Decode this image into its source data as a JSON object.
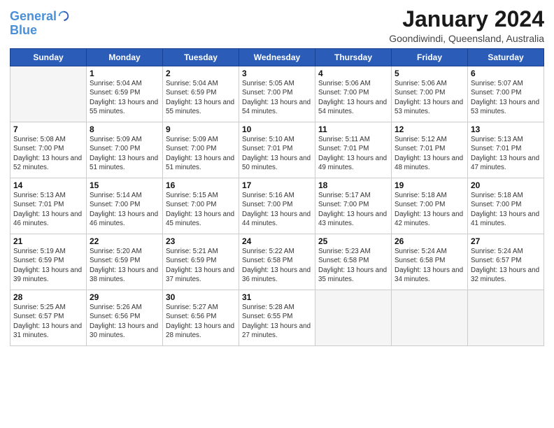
{
  "header": {
    "logo_line1": "General",
    "logo_line2": "Blue",
    "month": "January 2024",
    "location": "Goondiwindi, Queensland, Australia"
  },
  "weekdays": [
    "Sunday",
    "Monday",
    "Tuesday",
    "Wednesday",
    "Thursday",
    "Friday",
    "Saturday"
  ],
  "weeks": [
    [
      {
        "day": null
      },
      {
        "day": 1,
        "sunrise": "5:04 AM",
        "sunset": "6:59 PM",
        "daylight": "13 hours and 55 minutes."
      },
      {
        "day": 2,
        "sunrise": "5:04 AM",
        "sunset": "6:59 PM",
        "daylight": "13 hours and 55 minutes."
      },
      {
        "day": 3,
        "sunrise": "5:05 AM",
        "sunset": "7:00 PM",
        "daylight": "13 hours and 54 minutes."
      },
      {
        "day": 4,
        "sunrise": "5:06 AM",
        "sunset": "7:00 PM",
        "daylight": "13 hours and 54 minutes."
      },
      {
        "day": 5,
        "sunrise": "5:06 AM",
        "sunset": "7:00 PM",
        "daylight": "13 hours and 53 minutes."
      },
      {
        "day": 6,
        "sunrise": "5:07 AM",
        "sunset": "7:00 PM",
        "daylight": "13 hours and 53 minutes."
      }
    ],
    [
      {
        "day": 7,
        "sunrise": "5:08 AM",
        "sunset": "7:00 PM",
        "daylight": "13 hours and 52 minutes."
      },
      {
        "day": 8,
        "sunrise": "5:09 AM",
        "sunset": "7:00 PM",
        "daylight": "13 hours and 51 minutes."
      },
      {
        "day": 9,
        "sunrise": "5:09 AM",
        "sunset": "7:00 PM",
        "daylight": "13 hours and 51 minutes."
      },
      {
        "day": 10,
        "sunrise": "5:10 AM",
        "sunset": "7:01 PM",
        "daylight": "13 hours and 50 minutes."
      },
      {
        "day": 11,
        "sunrise": "5:11 AM",
        "sunset": "7:01 PM",
        "daylight": "13 hours and 49 minutes."
      },
      {
        "day": 12,
        "sunrise": "5:12 AM",
        "sunset": "7:01 PM",
        "daylight": "13 hours and 48 minutes."
      },
      {
        "day": 13,
        "sunrise": "5:13 AM",
        "sunset": "7:01 PM",
        "daylight": "13 hours and 47 minutes."
      }
    ],
    [
      {
        "day": 14,
        "sunrise": "5:13 AM",
        "sunset": "7:01 PM",
        "daylight": "13 hours and 46 minutes."
      },
      {
        "day": 15,
        "sunrise": "5:14 AM",
        "sunset": "7:00 PM",
        "daylight": "13 hours and 46 minutes."
      },
      {
        "day": 16,
        "sunrise": "5:15 AM",
        "sunset": "7:00 PM",
        "daylight": "13 hours and 45 minutes."
      },
      {
        "day": 17,
        "sunrise": "5:16 AM",
        "sunset": "7:00 PM",
        "daylight": "13 hours and 44 minutes."
      },
      {
        "day": 18,
        "sunrise": "5:17 AM",
        "sunset": "7:00 PM",
        "daylight": "13 hours and 43 minutes."
      },
      {
        "day": 19,
        "sunrise": "5:18 AM",
        "sunset": "7:00 PM",
        "daylight": "13 hours and 42 minutes."
      },
      {
        "day": 20,
        "sunrise": "5:18 AM",
        "sunset": "7:00 PM",
        "daylight": "13 hours and 41 minutes."
      }
    ],
    [
      {
        "day": 21,
        "sunrise": "5:19 AM",
        "sunset": "6:59 PM",
        "daylight": "13 hours and 39 minutes."
      },
      {
        "day": 22,
        "sunrise": "5:20 AM",
        "sunset": "6:59 PM",
        "daylight": "13 hours and 38 minutes."
      },
      {
        "day": 23,
        "sunrise": "5:21 AM",
        "sunset": "6:59 PM",
        "daylight": "13 hours and 37 minutes."
      },
      {
        "day": 24,
        "sunrise": "5:22 AM",
        "sunset": "6:58 PM",
        "daylight": "13 hours and 36 minutes."
      },
      {
        "day": 25,
        "sunrise": "5:23 AM",
        "sunset": "6:58 PM",
        "daylight": "13 hours and 35 minutes."
      },
      {
        "day": 26,
        "sunrise": "5:24 AM",
        "sunset": "6:58 PM",
        "daylight": "13 hours and 34 minutes."
      },
      {
        "day": 27,
        "sunrise": "5:24 AM",
        "sunset": "6:57 PM",
        "daylight": "13 hours and 32 minutes."
      }
    ],
    [
      {
        "day": 28,
        "sunrise": "5:25 AM",
        "sunset": "6:57 PM",
        "daylight": "13 hours and 31 minutes."
      },
      {
        "day": 29,
        "sunrise": "5:26 AM",
        "sunset": "6:56 PM",
        "daylight": "13 hours and 30 minutes."
      },
      {
        "day": 30,
        "sunrise": "5:27 AM",
        "sunset": "6:56 PM",
        "daylight": "13 hours and 28 minutes."
      },
      {
        "day": 31,
        "sunrise": "5:28 AM",
        "sunset": "6:55 PM",
        "daylight": "13 hours and 27 minutes."
      },
      {
        "day": null
      },
      {
        "day": null
      },
      {
        "day": null
      }
    ]
  ]
}
